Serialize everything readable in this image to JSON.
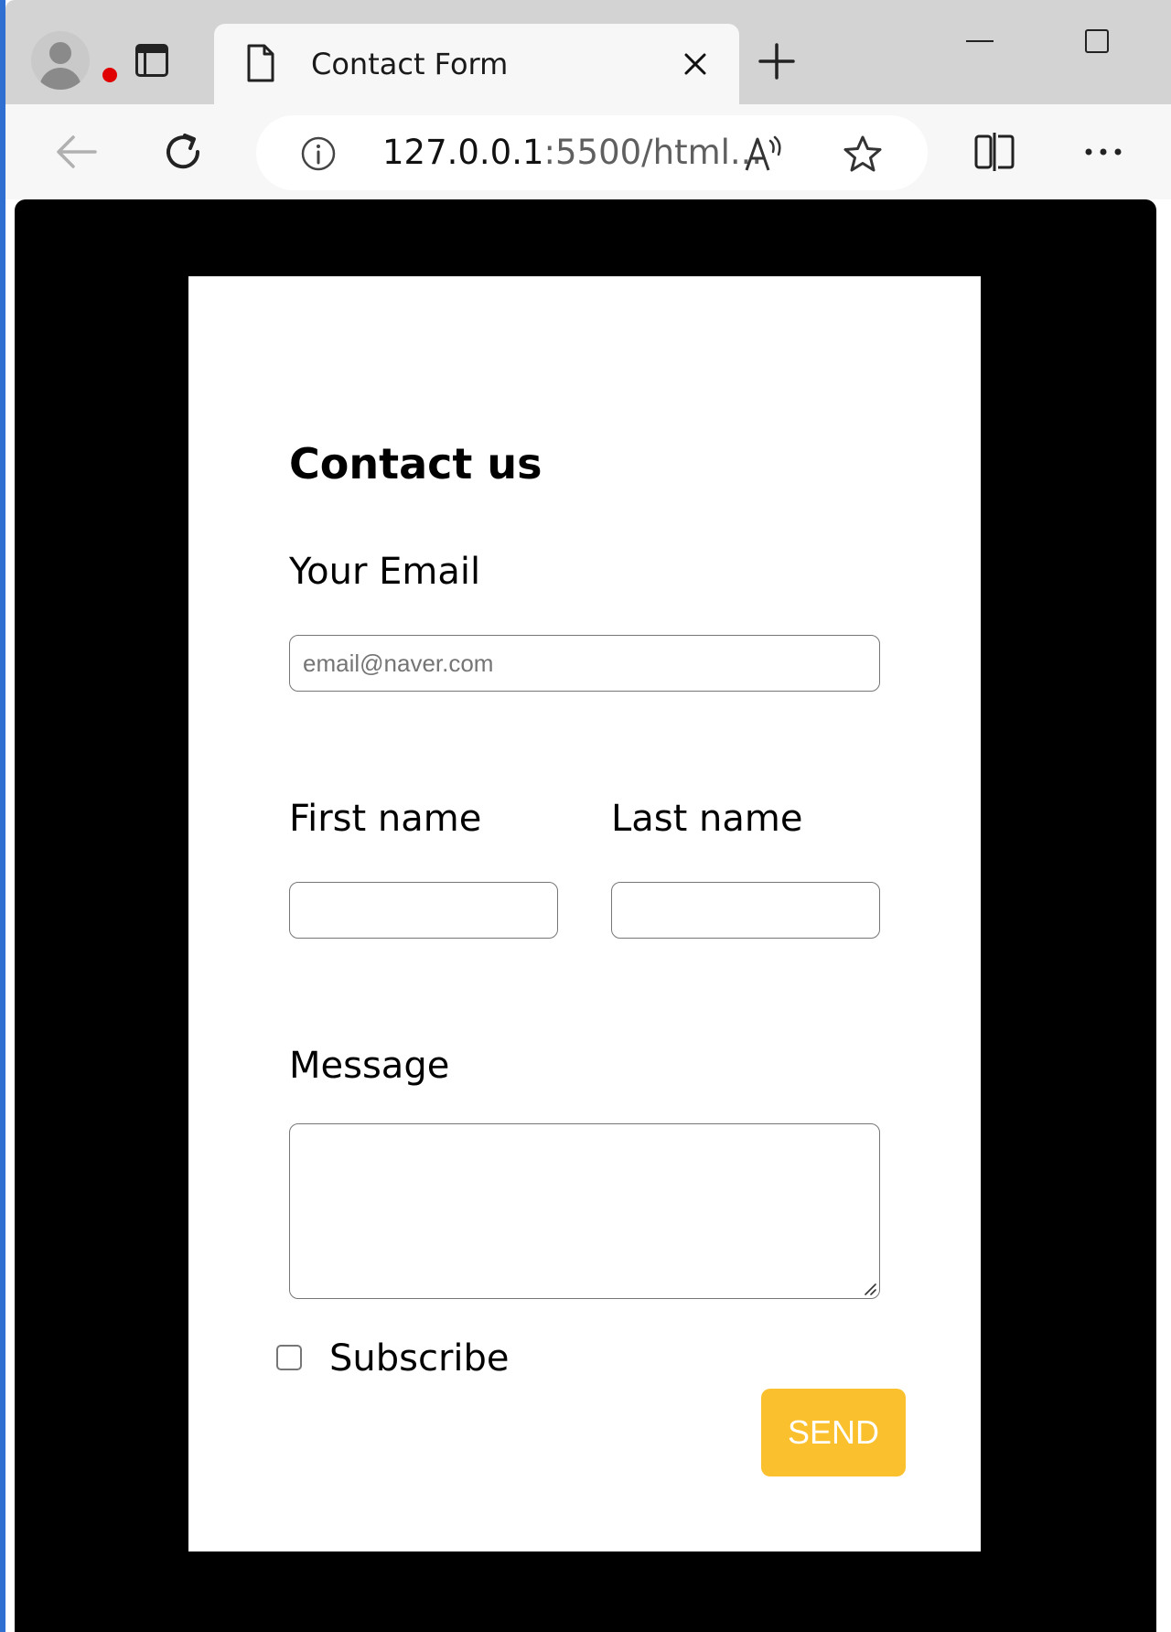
{
  "browser": {
    "tab_title": "Contact Form",
    "url_host": "127.0.0.1",
    "url_rest": ":5500/html...",
    "icons": [
      "profile-avatar-icon",
      "tab-actions-icon",
      "document-icon",
      "close-icon",
      "plus-icon",
      "minimize-icon",
      "maximize-icon",
      "back-arrow-icon",
      "reload-icon",
      "info-icon",
      "read-aloud-icon",
      "favorite-star-icon",
      "split-screen-icon",
      "more-icon"
    ],
    "notification_color": "#e00000"
  },
  "form": {
    "title": "Contact us",
    "email_label": "Your Email",
    "email_placeholder": "email@naver.com",
    "email_value": "",
    "first_name_label": "First name",
    "first_name_value": "",
    "last_name_label": "Last name",
    "last_name_value": "",
    "message_label": "Message",
    "message_value": "",
    "subscribe_label": "Subscribe",
    "subscribe_checked": false,
    "send_label": "SEND",
    "send_color": "#fbc02d",
    "page_background": "#000000"
  }
}
